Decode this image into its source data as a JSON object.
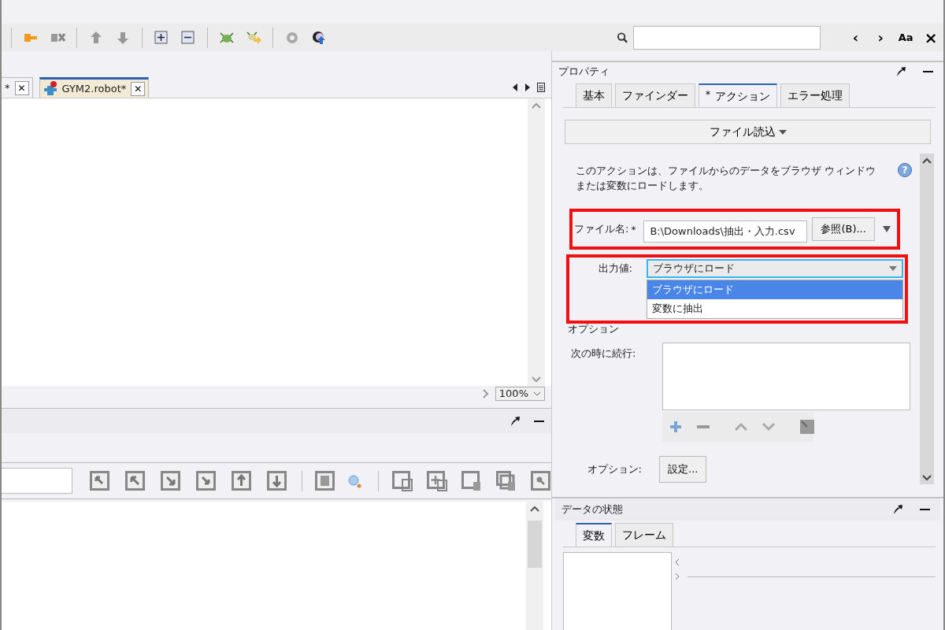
{
  "find_bar": {
    "prev": "‹",
    "next": "›",
    "match_case": "Aa",
    "close": "×"
  },
  "editor": {
    "tabs": [
      {
        "label": "*",
        "selected": false,
        "close": "✕"
      },
      {
        "label": "GYM2.robot*",
        "selected": true,
        "close": "✕"
      }
    ],
    "zoom": "100%"
  },
  "properties": {
    "title": "プロパティ",
    "tabs": [
      {
        "label": "基本",
        "selected": false
      },
      {
        "label": "ファインダー",
        "selected": false
      },
      {
        "label": "アクション",
        "selected": true,
        "mark": "*"
      },
      {
        "label": "エラー処理",
        "selected": false
      }
    ],
    "action_menu": "ファイル読込",
    "description": "このアクションは、ファイルからのデータをブラウザ ウィンドウまたは変数にロードします。",
    "help": "?",
    "file_name": {
      "label": "ファイル名:",
      "required_mark": "*",
      "value": "B:\\Downloads\\抽出・入力.csv",
      "browse": "参照(B)...",
      "highlighted": true
    },
    "output": {
      "label": "出力値:",
      "value": "ブラウザにロード",
      "expanded": true,
      "highlighted": true,
      "options": [
        {
          "label": "ブラウザにロード",
          "selected": true
        },
        {
          "label": "変数に抽出",
          "selected": false
        }
      ]
    },
    "section_label": "オプション",
    "continue_on": {
      "label": "次の時に続行:"
    },
    "options_row": {
      "label": "オプション:",
      "button": "設定..."
    }
  },
  "data_state": {
    "title": "データの状態",
    "tabs": [
      {
        "label": "変数",
        "selected": true
      },
      {
        "label": "フレーム",
        "selected": false
      }
    ]
  }
}
